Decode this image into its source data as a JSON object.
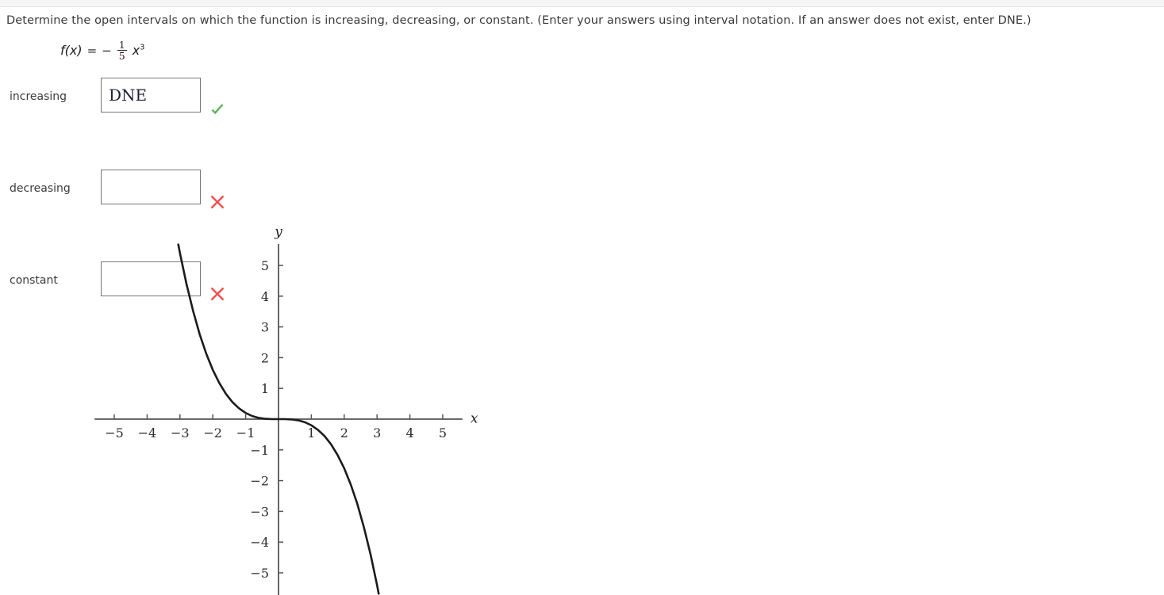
{
  "question": {
    "prompt": "Determine the open intervals on which the function is increasing, decreasing, or constant. (Enter your answers using interval notation. If an answer does not exist, enter DNE.)"
  },
  "formula": {
    "function_name": "f(x)",
    "equals": "=",
    "sign": "−",
    "numerator": "1",
    "denominator": "5",
    "variable": "x",
    "exponent": "3",
    "full_text": "f(x) = − (1/5)x³"
  },
  "answers": {
    "rows": [
      {
        "label": "increasing",
        "value": "DNE",
        "placeholder": "",
        "mark": "check-icon",
        "mark_color": "#5cb85c",
        "status": "correct"
      },
      {
        "label": "decreasing",
        "value": "",
        "placeholder": "",
        "mark": "cross-icon",
        "mark_color": "#ef5350",
        "status": "incorrect"
      },
      {
        "label": "constant",
        "value": "",
        "placeholder": "",
        "mark": "cross-icon",
        "mark_color": "#ef5350",
        "status": "incorrect"
      }
    ]
  },
  "chart_data": {
    "type": "line",
    "title": "",
    "xlabel": "x",
    "ylabel": "y",
    "xlim": [
      -5.6,
      5.6
    ],
    "ylim": [
      -5.7,
      5.7
    ],
    "x_ticks": [
      -5,
      -4,
      -3,
      -2,
      -1,
      1,
      2,
      3,
      4,
      5
    ],
    "x_tick_labels": [
      "−5",
      "−4",
      "−3",
      "−2",
      "−1",
      "1",
      "2",
      "3",
      "4",
      "5"
    ],
    "y_ticks": [
      -5,
      -4,
      -3,
      -2,
      -1,
      1,
      2,
      3,
      4,
      5
    ],
    "y_tick_labels": [
      "−5",
      "−4",
      "−3",
      "−2",
      "−1",
      "1",
      "2",
      "3",
      "4",
      "5"
    ],
    "grid": false,
    "legend": "none",
    "curve_color": "#1c1c1c",
    "axis_color": "#555555",
    "series": [
      {
        "name": "f(x) = -x^3/5",
        "equation": "y = -(1/5)x^3",
        "points": [
          {
            "x": -3.05,
            "y": 5.68
          },
          {
            "x": -3.0,
            "y": 5.4
          },
          {
            "x": -2.8,
            "y": 4.39
          },
          {
            "x": -2.6,
            "y": 3.52
          },
          {
            "x": -2.4,
            "y": 2.76
          },
          {
            "x": -2.2,
            "y": 2.13
          },
          {
            "x": -2.0,
            "y": 1.6
          },
          {
            "x": -1.8,
            "y": 1.17
          },
          {
            "x": -1.6,
            "y": 0.82
          },
          {
            "x": -1.4,
            "y": 0.55
          },
          {
            "x": -1.2,
            "y": 0.35
          },
          {
            "x": -1.0,
            "y": 0.2
          },
          {
            "x": -0.8,
            "y": 0.1
          },
          {
            "x": -0.6,
            "y": 0.04
          },
          {
            "x": -0.4,
            "y": 0.01
          },
          {
            "x": -0.2,
            "y": 0.0
          },
          {
            "x": 0.0,
            "y": 0.0
          },
          {
            "x": 0.2,
            "y": 0.0
          },
          {
            "x": 0.4,
            "y": -0.01
          },
          {
            "x": 0.6,
            "y": -0.04
          },
          {
            "x": 0.8,
            "y": -0.1
          },
          {
            "x": 1.0,
            "y": -0.2
          },
          {
            "x": 1.2,
            "y": -0.35
          },
          {
            "x": 1.4,
            "y": -0.55
          },
          {
            "x": 1.6,
            "y": -0.82
          },
          {
            "x": 1.8,
            "y": -1.17
          },
          {
            "x": 2.0,
            "y": -1.6
          },
          {
            "x": 2.2,
            "y": -2.13
          },
          {
            "x": 2.4,
            "y": -2.76
          },
          {
            "x": 2.6,
            "y": -3.52
          },
          {
            "x": 2.8,
            "y": -4.39
          },
          {
            "x": 3.0,
            "y": -5.4
          },
          {
            "x": 3.05,
            "y": -5.68
          }
        ]
      }
    ]
  }
}
